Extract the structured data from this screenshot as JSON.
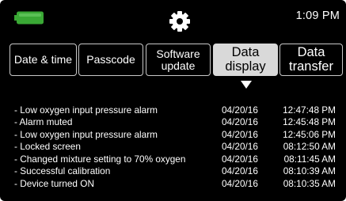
{
  "status_bar": {
    "time": "1:09 PM",
    "battery_level": 1.0,
    "battery_color": "#3aa835",
    "battery_icon": "battery-icon",
    "settings_icon": "gear-icon"
  },
  "tabs": [
    {
      "label": "Date & time",
      "active": false
    },
    {
      "label": "Passcode",
      "active": false
    },
    {
      "label": "Software\nupdate",
      "active": false
    },
    {
      "label": "Data\ndisplay",
      "active": true
    },
    {
      "label": "Data\ntransfer",
      "active": false
    }
  ],
  "log": [
    {
      "message": "- Low oxygen input pressure alarm",
      "date": "04/20/16",
      "time": "12:47:48 PM"
    },
    {
      "message": "- Alarm muted",
      "date": "04/20/16",
      "time": "12:45:48 PM"
    },
    {
      "message": "- Low oxygen input pressure alarm",
      "date": "04/20/16",
      "time": "12:45:06 PM"
    },
    {
      "message": "- Locked screen",
      "date": "04/20/16",
      "time": "08:12:50 AM"
    },
    {
      "message": "- Changed mixture setting to 70% oxygen",
      "date": "04/20/16",
      "time": "08:11:45 AM"
    },
    {
      "message": "- Successful calibration",
      "date": "04/20/16",
      "time": "08:10:39 AM"
    },
    {
      "message": "- Device turned ON",
      "date": "04/20/16",
      "time": "08:10:35 AM"
    }
  ]
}
